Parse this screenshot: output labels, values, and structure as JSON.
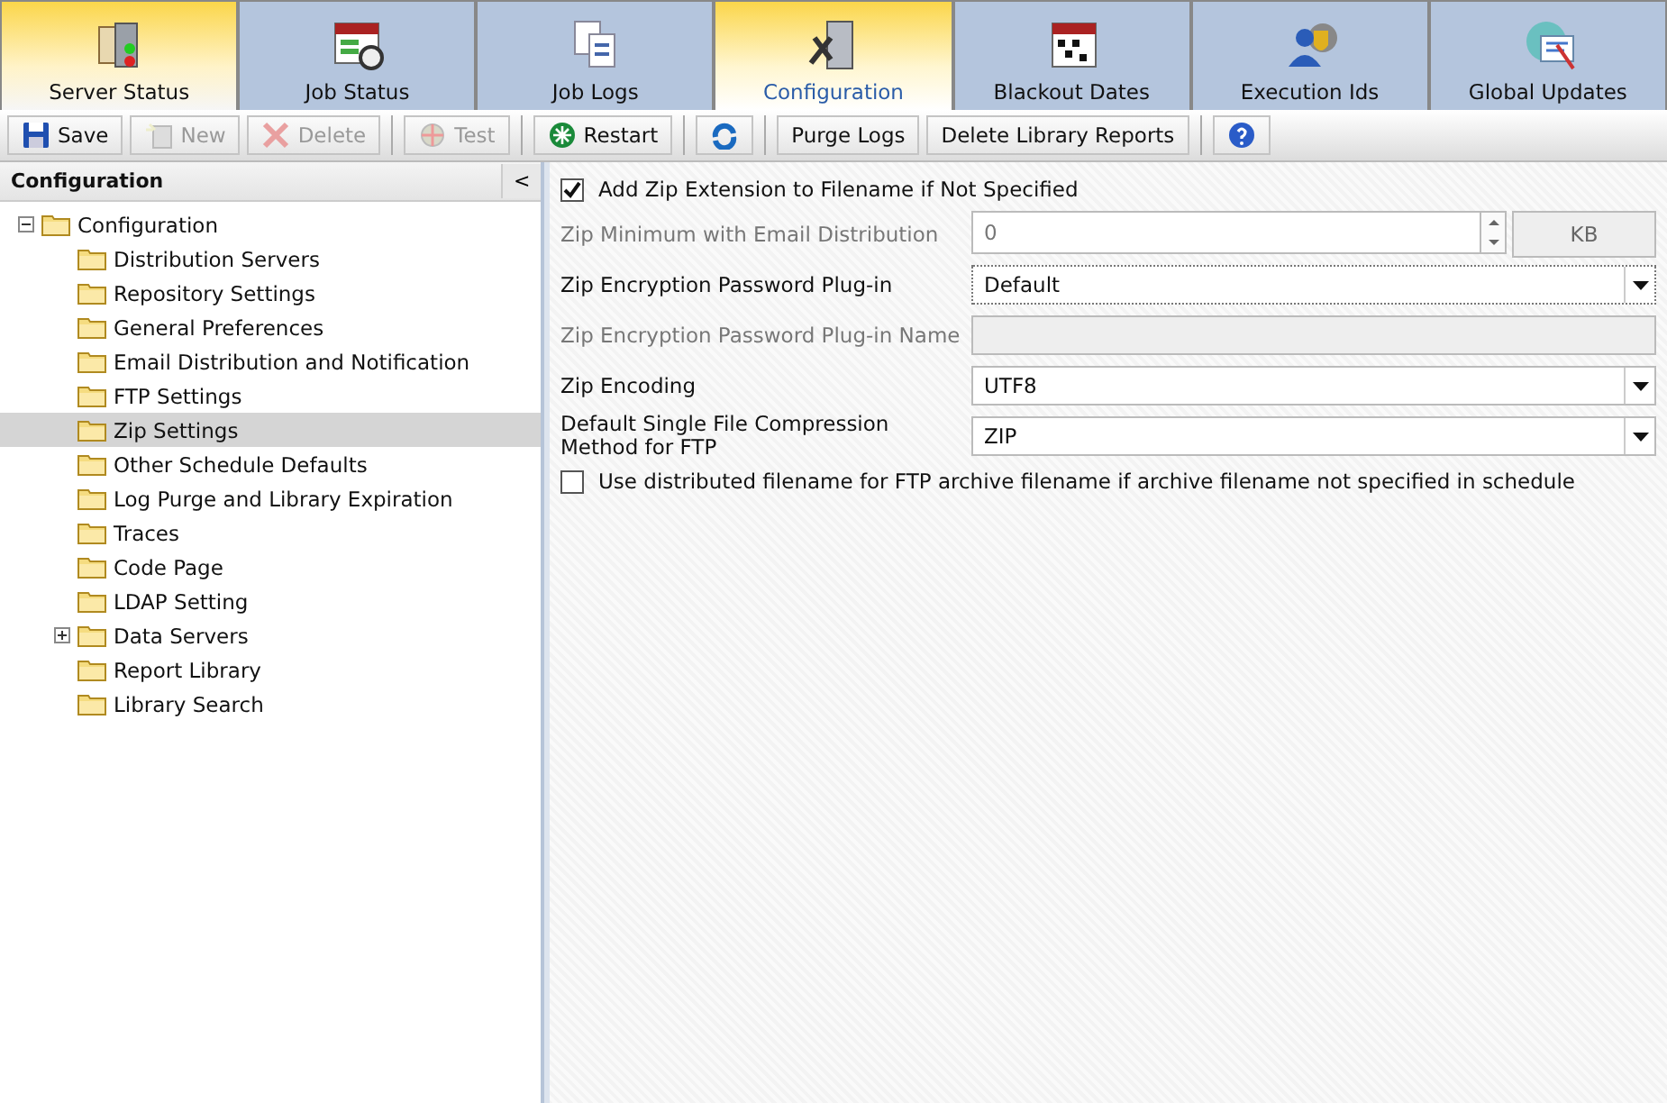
{
  "tabs": [
    {
      "label": "Server Status",
      "selected": false,
      "highlight": true
    },
    {
      "label": "Job Status",
      "selected": false,
      "highlight": false
    },
    {
      "label": "Job Logs",
      "selected": false,
      "highlight": false
    },
    {
      "label": "Configuration",
      "selected": true,
      "highlight": false
    },
    {
      "label": "Blackout Dates",
      "selected": false,
      "highlight": false
    },
    {
      "label": "Execution Ids",
      "selected": false,
      "highlight": false
    },
    {
      "label": "Global Updates",
      "selected": false,
      "highlight": false
    }
  ],
  "toolbar": [
    {
      "kind": "labeled",
      "label": "Save",
      "disabled": false
    },
    {
      "kind": "labeled",
      "label": "New",
      "disabled": true
    },
    {
      "kind": "labeled",
      "label": "Delete",
      "disabled": true
    },
    {
      "kind": "labeled",
      "label": "Test",
      "disabled": true
    },
    {
      "kind": "labeled",
      "label": "Restart",
      "disabled": false
    },
    {
      "kind": "icon"
    },
    {
      "kind": "labeled",
      "label": "Purge Logs",
      "disabled": false
    },
    {
      "kind": "labeled",
      "label": "Delete Library Reports",
      "disabled": false
    },
    {
      "kind": "icon"
    }
  ],
  "sidebar": {
    "title": "Configuration",
    "collapse": "<",
    "tree": [
      {
        "label": "Configuration",
        "expanded": true,
        "selected": false,
        "children": [
          {
            "label": "Distribution Servers",
            "selected": false
          },
          {
            "label": "Repository Settings",
            "selected": false
          },
          {
            "label": "General Preferences",
            "selected": false
          },
          {
            "label": "Email Distribution and Notification",
            "selected": false
          },
          {
            "label": "FTP Settings",
            "selected": false
          },
          {
            "label": "Zip Settings",
            "selected": true
          },
          {
            "label": "Other Schedule Defaults",
            "selected": false
          },
          {
            "label": "Log Purge and Library Expiration",
            "selected": false
          },
          {
            "label": "Traces",
            "selected": false
          },
          {
            "label": "Code Page",
            "selected": false
          },
          {
            "label": "LDAP Setting",
            "selected": false
          },
          {
            "label": "Data Servers",
            "selected": false,
            "expanded": false
          },
          {
            "label": "Report Library",
            "selected": false
          },
          {
            "label": "Library Search",
            "selected": false
          }
        ]
      }
    ]
  },
  "form": [
    {
      "kind": "checkbox",
      "label": "Add Zip Extension to Filename if Not Specified",
      "checked": true
    },
    {
      "kind": "spinner",
      "label": "Zip Minimum with Email Distribution",
      "value": "0",
      "unit": "KB",
      "disabled": true
    },
    {
      "kind": "select",
      "label": "Zip Encryption Password Plug-in",
      "value": "Default",
      "disabled": false,
      "focused": true
    },
    {
      "kind": "text",
      "label": "Zip Encryption Password Plug-in Name",
      "disabled": true
    },
    {
      "kind": "select",
      "label": "Zip Encoding",
      "value": "UTF8",
      "disabled": false,
      "focused": false
    },
    {
      "kind": "select",
      "label": "Default Single File Compression Method for FTP",
      "value": "ZIP",
      "disabled": false,
      "focused": false
    },
    {
      "kind": "checkbox",
      "label": "Use distributed filename for FTP archive filename if archive filename not specified in schedule",
      "checked": false
    }
  ]
}
